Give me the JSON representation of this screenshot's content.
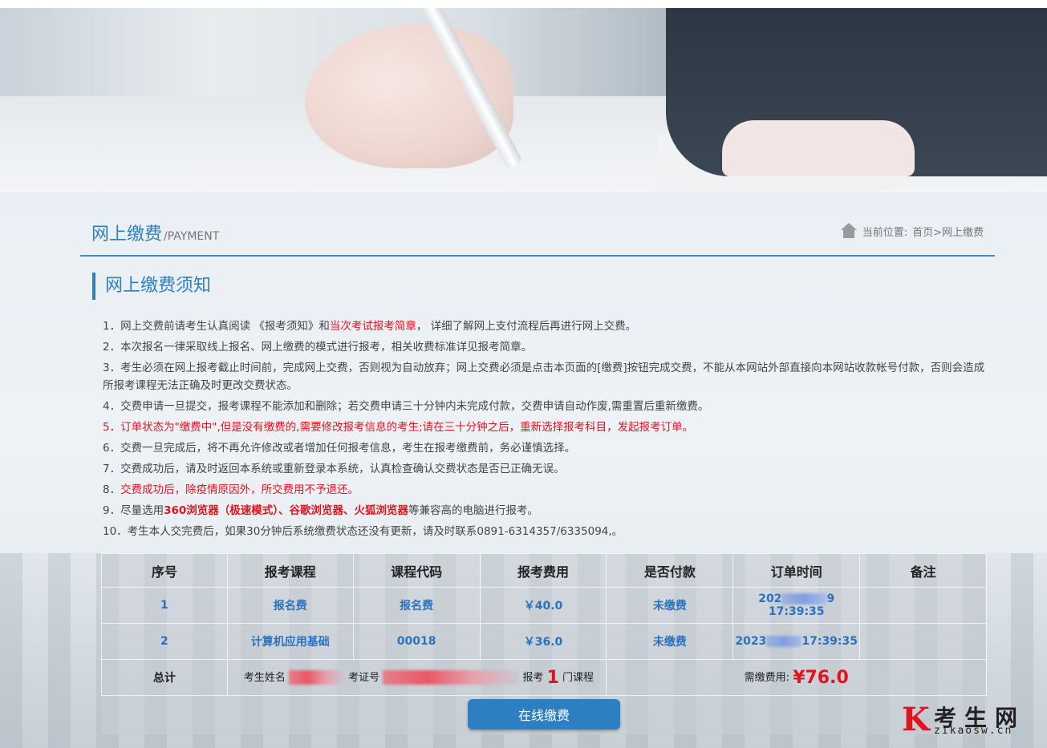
{
  "header": {
    "title": "网上缴费",
    "subtitle": "/PAYMENT",
    "breadcrumb_prefix": "当前位置:",
    "breadcrumb": "首页>网上缴费"
  },
  "notice": {
    "title": "网上缴费须知",
    "items": {
      "1a": "1．网上交费前请考生认真阅读 《报考须知》和",
      "1b": "当次考试报考简章",
      "1c": "， 详细了解网上支付流程后再进行网上交费。",
      "2": "2．本次报名一律采取线上报名、网上缴费的模式进行报考，相关收费标准详见报考简章。",
      "3": "3．考生必须在网上报考截止时间前，完成网上交费，否则视为自动放弃；网上交费必须是点击本页面的[缴费]按钮完成交费，不能从本网站外部直接向本网站收款帐号付款，否则会造成所报考课程无法正确及时更改交费状态。",
      "4": "4．交费申请一旦提交，报考课程不能添加和删除；若交费申请三十分钟内未完成付款，交费申请自动作废,需重置后重新缴费。",
      "5": "5．订单状态为\"缴费中\",但是没有缴费的,需要修改报考信息的考生;请在三十分钟之后，重新选择报考科目，发起报考订单。",
      "6": "6．交费一旦完成后，将不再允许修改或者增加任何报考信息，考生在报考缴费前，务必谨慎选择。",
      "7": "7．交费成功后，请及时返回本系统或重新登录本系统，认真检查确认交费状态是否已正确无误。",
      "8a": "8．",
      "8b": "交费成功后，除疫情原因外，所交费用不予退还。",
      "9a": "9．尽量选用",
      "9b": "360浏览器（极速模式）、谷歌浏览器、火狐浏览器",
      "9c": "等兼容高的电脑进行报考。",
      "10": "10．考生本人交完费后，如果30分钟后系统缴费状态还没有更新，请及时联系0891-6314357/6335094,。"
    }
  },
  "table": {
    "headers": [
      "序号",
      "报考课程",
      "课程代码",
      "报考费用",
      "是否付款",
      "订单时间",
      "备注"
    ],
    "rows": [
      {
        "no": "1",
        "course": "报名费",
        "code": "报名费",
        "fee": "￥40.0",
        "paid": "未缴费",
        "time_a": "202",
        "time_b": "9 17:39:35",
        "note": ""
      },
      {
        "no": "2",
        "course": "计算机应用基础",
        "code": "00018",
        "fee": "￥36.0",
        "paid": "未缴费",
        "time_a": "2023",
        "time_b": "17:39:35",
        "note": ""
      }
    ],
    "total": {
      "label": "总计",
      "name_label": "考生姓名",
      "id_label": "考证号",
      "count_prefix": "报考",
      "count": "1",
      "count_suffix": "门课程",
      "fee_label": "需缴费用:",
      "fee": "¥76.0"
    }
  },
  "pay_button": "在线缴费",
  "watermark": {
    "logo": "K",
    "name": "考生网",
    "domain": "zikaosw.cn"
  }
}
